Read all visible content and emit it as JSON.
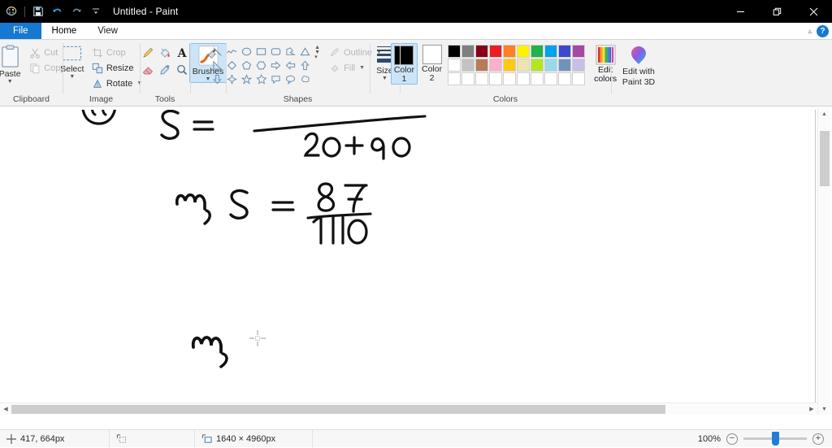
{
  "window": {
    "title": "Untitled - Paint",
    "quick_access": [
      "paint-app-icon",
      "save-icon",
      "undo-icon",
      "redo-icon",
      "customize-qat-icon"
    ],
    "controls": {
      "minimize": "minimize-icon",
      "restore": "restore-icon",
      "close": "close-icon"
    }
  },
  "tabs": [
    {
      "label": "File",
      "name": "tab-file"
    },
    {
      "label": "Home",
      "name": "tab-home"
    },
    {
      "label": "View",
      "name": "tab-view"
    }
  ],
  "tabstrip_right": {
    "collapse_ribbon": "chevron-up-icon",
    "help": "?"
  },
  "ribbon": {
    "clipboard": {
      "label": "Clipboard",
      "paste": "Paste",
      "cut": "Cut",
      "copy": "Copy"
    },
    "image": {
      "label": "Image",
      "select": "Select",
      "crop": "Crop",
      "resize": "Resize",
      "rotate": "Rotate"
    },
    "tools": {
      "label": "Tools",
      "items": [
        "pencil-icon",
        "fill-with-color-icon",
        "text-icon",
        "eraser-icon",
        "color-picker-icon",
        "magnifier-icon"
      ]
    },
    "brushes": {
      "label": "Brushes"
    },
    "shapes": {
      "label": "Shapes",
      "outline": "Outline",
      "fill": "Fill",
      "items": [
        "line-shape",
        "curve-shape",
        "oval-shape",
        "rectangle-shape",
        "rounded-rectangle-shape",
        "polygon-shape",
        "triangle-shape",
        "right-triangle-shape",
        "diamond-shape",
        "pentagon-shape",
        "hexagon-shape",
        "right-arrow-shape",
        "left-arrow-shape",
        "up-arrow-shape",
        "down-arrow-shape",
        "four-point-star-shape",
        "five-point-star-shape",
        "six-point-star-shape",
        "rounded-callout-shape",
        "oval-callout-shape",
        "cloud-callout-shape"
      ]
    },
    "size": {
      "label": "Size"
    },
    "colors": {
      "label": "Colors",
      "color1_label": "Color\n1",
      "color1_line1": "Color",
      "color1_line2": "1",
      "color2_line1": "Color",
      "color2_line2": "2",
      "color1_value": "#000000",
      "color2_value": "#ffffff",
      "palette_row1": [
        "#000000",
        "#7f7f7f",
        "#880015",
        "#ed1c24",
        "#ff7f27",
        "#fff200",
        "#22b14c",
        "#00a2e8",
        "#3f48cc",
        "#a349a4"
      ],
      "palette_row2": [
        "#ffffff",
        "#c3c3c3",
        "#b97a57",
        "#ffaec9",
        "#ffc90e",
        "#efe4b0",
        "#b5e61d",
        "#99d9ea",
        "#7092be",
        "#c8bfe7"
      ],
      "palette_row3": [
        "",
        "",
        "",
        "",
        "",
        "",
        "",
        "",
        "",
        ""
      ],
      "edit_colors_line1": "Edit",
      "edit_colors_line2": "colors"
    },
    "paint3d": {
      "line1": "Edit with",
      "line2": "Paint 3D"
    }
  },
  "canvas": {
    "strokes": [
      {
        "name": "circled-char-partial",
        "text": "ʘ"
      },
      {
        "name": "expr-s-equals",
        "text": "S  ="
      },
      {
        "name": "expr-denominator",
        "text": "20 + 90"
      },
      {
        "name": "expr-therefore-1",
        "text": "∴,"
      },
      {
        "name": "expr-s-equals-2",
        "text": "S   ="
      },
      {
        "name": "expr-numerator-87",
        "text": "87"
      },
      {
        "name": "expr-denominator-110",
        "text": "110"
      },
      {
        "name": "expr-therefore-2",
        "text": "∴,"
      }
    ]
  },
  "statusbar": {
    "cursor_position": "417, 664px",
    "selection_size": "",
    "image_size": "1640 × 4960px",
    "zoom_level": "100%",
    "zoom_out": "−",
    "zoom_in": "+"
  }
}
